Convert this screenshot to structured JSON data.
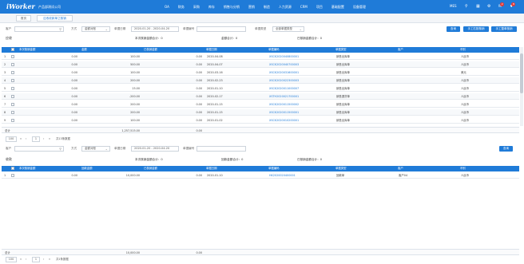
{
  "topbar": {
    "logo": "iWorker",
    "company": "产品部测试公司",
    "nav": [
      "OA",
      "财务",
      "采购",
      "库存",
      "销售与分销",
      "营销",
      "制造",
      "人力资源",
      "CRM",
      "项目",
      "基础配置",
      "设备管理"
    ],
    "mes": "MES",
    "icons": [
      "search-icon",
      "layout-icon",
      "settings-icon",
      "message-icon",
      "notification-icon"
    ],
    "badges": [
      "2",
      "8"
    ]
  },
  "tabs": [
    "首页",
    "应收收款单之核销"
  ],
  "filter1": {
    "customer_label": "客户",
    "type_label": "方式",
    "type_value": "金额对账",
    "date_label": "单据日期",
    "date_value": "2020-01-20 - 2020-04-20",
    "docno_label": "单据编号",
    "doctype_label": "单据类型",
    "doctype_value": "全部单据类型",
    "search_btn": "查询",
    "auto_btn": "手工匹配核销",
    "manual_btn": "手工整单核销"
  },
  "section1": {
    "title": "应收",
    "sum1": "本次核销金额合计：0",
    "sum2": "金额合计：0",
    "sum3": "已核销金额合计：0",
    "columns": [
      "",
      "",
      "本次核销金额",
      "金额",
      "已核销金额",
      "单据日期",
      "单据编码",
      "单据类型",
      "客户",
      "币别"
    ],
    "rows": [
      [
        "1",
        "0.00",
        "100.00",
        "0.00",
        "2020-04-08",
        "XSCK2020040800001",
        "销售出库单",
        "",
        "人民币"
      ],
      [
        "2",
        "0.00",
        "500.00",
        "0.00",
        "2020-04-07",
        "XSCK2020040700003",
        "销售出库单",
        "",
        "人民币"
      ],
      [
        "3",
        "0.00",
        "100.00",
        "0.00",
        "2020-03-16",
        "XSCK2020031600001",
        "销售出库单",
        "",
        "美元"
      ],
      [
        "4",
        "0.00",
        "200.00",
        "0.00",
        "2020-02-23",
        "XSCK2020022300003",
        "销售出库单",
        "",
        "人民币"
      ],
      [
        "5",
        "0.00",
        "15.00",
        "0.00",
        "2020-01-10",
        "XSCK2020011000007",
        "销售出库单",
        "",
        "人民币"
      ],
      [
        "6",
        "0.00",
        "-200.00",
        "0.00",
        "2020-02-17",
        "XSTH2020021700001",
        "销售退货单",
        "",
        "人民币"
      ],
      [
        "7",
        "0.00",
        "200.00",
        "0.00",
        "2020-01-15",
        "XSCK2020011500002",
        "销售出库单",
        "",
        "人民币"
      ],
      [
        "8",
        "0.00",
        "200.00",
        "0.00",
        "2020-01-15",
        "XSCK2020011500001",
        "销售出库单",
        "",
        "人民币"
      ],
      [
        "9",
        "0.00",
        "100.00",
        "0.00",
        "2020-01-02",
        "XSCK2020010200001",
        "销售出库单",
        "",
        "人民币"
      ]
    ],
    "total_label": "总计",
    "total_amount": "1,257,515.00",
    "total_settled": "0.00",
    "pager": {
      "size": "100",
      "page": "1",
      "info": "共13条数据"
    }
  },
  "filter2": {
    "customer_label": "客户",
    "type_label": "方式",
    "type_value": "金额对账",
    "date_label": "单据日期",
    "date_value": "2020-01-20 - 2020-04-20",
    "docno_label": "单据编号",
    "search_btn": "查询"
  },
  "section2": {
    "title": "收款",
    "sum1": "本次核销金额合计：0",
    "sum2": "回款金额合计：0",
    "sum3": "已核销金额合计：0",
    "columns": [
      "",
      "",
      "本次核销金额",
      "回款金额",
      "已核销金额",
      "单据日期",
      "单据编码",
      "单据类型",
      "客户",
      "币别"
    ],
    "rows": [
      [
        "1",
        "0.00",
        "10,000.00",
        "0.00",
        "2020-01-10",
        "HK2020020400001",
        "回款单",
        "客户04",
        "人民币"
      ]
    ],
    "total_label": "总计",
    "total_amount": "10,000.00",
    "total_settled": "0.00",
    "pager": {
      "size": "100",
      "page": "1",
      "info": "共1条数据"
    }
  }
}
